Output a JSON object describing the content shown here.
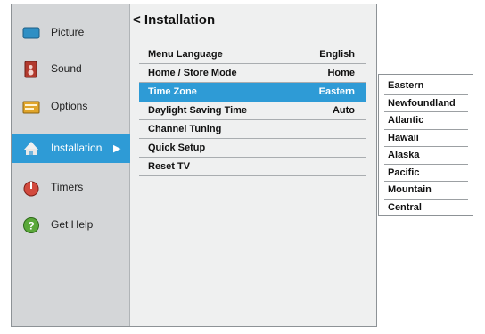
{
  "menu": {
    "title": "< Installation",
    "sidebar": [
      {
        "label": "Picture",
        "icon": "picture-icon"
      },
      {
        "label": "Sound",
        "icon": "speaker-icon"
      },
      {
        "label": "Options",
        "icon": "options-icon"
      },
      {
        "label": "Installation",
        "icon": "installation-icon",
        "active": true
      },
      {
        "label": "Timers",
        "icon": "timer-icon"
      },
      {
        "label": "Get Help",
        "icon": "help-icon"
      }
    ],
    "active_arrow": "▶",
    "rows": [
      {
        "label": "Menu Language",
        "value": "English"
      },
      {
        "label": "Home / Store Mode",
        "value": "Home"
      },
      {
        "label": "Time Zone",
        "value": "Eastern",
        "selected": true
      },
      {
        "label": "Daylight Saving Time",
        "value": "Auto"
      },
      {
        "label": "Channel Tuning",
        "value": ""
      },
      {
        "label": "Quick Setup",
        "value": ""
      },
      {
        "label": "Reset TV",
        "value": ""
      }
    ]
  },
  "timezone_dropdown": {
    "options": [
      "Eastern",
      "Newfoundland",
      "Atlantic",
      "Hawaii",
      "Alaska",
      "Pacific",
      "Mountain",
      "Central"
    ]
  },
  "colors": {
    "accent": "#2e9bd6",
    "sidebar": "#d4d6d8",
    "panel": "#eff0f0"
  }
}
